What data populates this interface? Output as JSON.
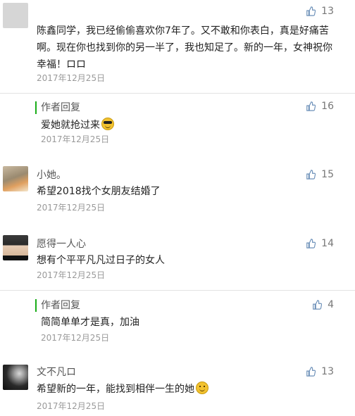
{
  "colors": {
    "reply_bar": "#1aad19",
    "meta_text": "#9a9a9a"
  },
  "comments": [
    {
      "author": "",
      "text": "陈鑫同学，我已经偷偷喜欢你7年了。又不敢和你表白，真是好痛苦啊。现在你也找到你的另一半了，我也知足了。新的一年，女神祝你幸福！ロロ",
      "date": "2017年12月25日",
      "likes": "13",
      "reply": {
        "label": "作者回复",
        "text": "爱她就抢过来",
        "emoji": "cool-sunglasses-emoji",
        "date": "2017年12月25日",
        "likes": "16"
      }
    },
    {
      "author": "小她。",
      "text": "希望2018找个女朋友结婚了",
      "date": "2017年12月25日",
      "likes": "15"
    },
    {
      "author": "愿得一人心",
      "text": "想有个平平凡凡过日子的女人",
      "date": "2017年12月25日",
      "likes": "14",
      "reply": {
        "label": "作者回复",
        "text": "简简单单才是真，加油",
        "date": "2017年12月25日",
        "likes": "4"
      }
    },
    {
      "author": "文不凡ロ",
      "text": "希望新的一年，能找到相伴一生的她",
      "emoji": "shy-smile-emoji",
      "date": "2017年12月25日",
      "likes": "13"
    }
  ]
}
